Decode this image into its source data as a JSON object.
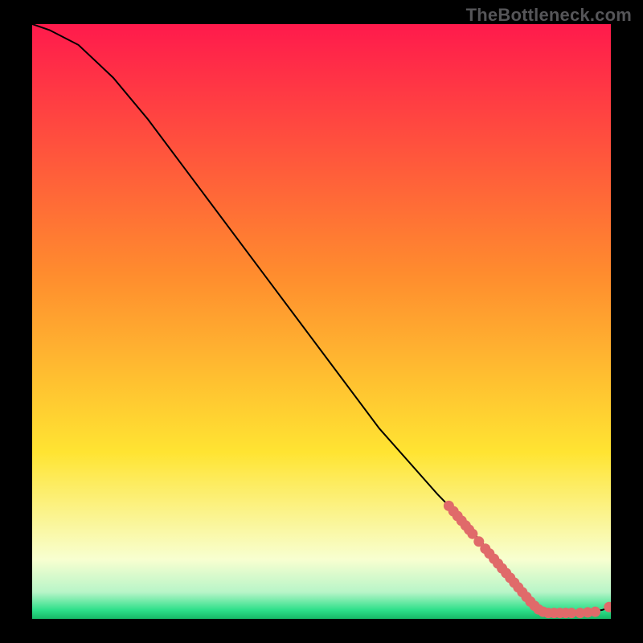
{
  "watermark": "TheBottleneck.com",
  "colors": {
    "page_bg": "#000000",
    "watermark": "#555558",
    "curve": "#000000",
    "marker_fill": "#e06a6a",
    "marker_stroke": "#c24f4f",
    "gradient_top": "#ff1a4c",
    "gradient_yellow": "#ffe432",
    "gradient_pale": "#f6ffe0",
    "gradient_green": "#2ee08a"
  },
  "chart_data": {
    "type": "line",
    "title": "",
    "xlabel": "",
    "ylabel": "",
    "xlim": [
      0,
      100
    ],
    "ylim": [
      0,
      100
    ],
    "curve": [
      {
        "x": 0,
        "y": 100
      },
      {
        "x": 3,
        "y": 99
      },
      {
        "x": 8,
        "y": 96.5
      },
      {
        "x": 14,
        "y": 91
      },
      {
        "x": 20,
        "y": 84
      },
      {
        "x": 30,
        "y": 71
      },
      {
        "x": 40,
        "y": 58
      },
      {
        "x": 50,
        "y": 45
      },
      {
        "x": 60,
        "y": 32
      },
      {
        "x": 70,
        "y": 21
      },
      {
        "x": 74,
        "y": 17
      },
      {
        "x": 78,
        "y": 12.5
      },
      {
        "x": 82,
        "y": 8
      },
      {
        "x": 85,
        "y": 4.5
      },
      {
        "x": 87,
        "y": 2.3
      },
      {
        "x": 88.5,
        "y": 1.2
      },
      {
        "x": 90,
        "y": 1.0
      },
      {
        "x": 93,
        "y": 1.0
      },
      {
        "x": 96,
        "y": 1.1
      },
      {
        "x": 98.5,
        "y": 1.5
      },
      {
        "x": 100,
        "y": 2.0
      }
    ],
    "markers": [
      {
        "x": 72.0,
        "y": 19.0
      },
      {
        "x": 72.8,
        "y": 18.1
      },
      {
        "x": 73.5,
        "y": 17.3
      },
      {
        "x": 74.2,
        "y": 16.5
      },
      {
        "x": 74.9,
        "y": 15.7
      },
      {
        "x": 75.5,
        "y": 15.0
      },
      {
        "x": 76.1,
        "y": 14.3
      },
      {
        "x": 77.2,
        "y": 13.0
      },
      {
        "x": 78.3,
        "y": 11.8
      },
      {
        "x": 79.0,
        "y": 11.0
      },
      {
        "x": 79.8,
        "y": 10.1
      },
      {
        "x": 80.5,
        "y": 9.3
      },
      {
        "x": 81.2,
        "y": 8.5
      },
      {
        "x": 81.9,
        "y": 7.7
      },
      {
        "x": 82.6,
        "y": 6.9
      },
      {
        "x": 83.3,
        "y": 6.1
      },
      {
        "x": 84.0,
        "y": 5.3
      },
      {
        "x": 84.7,
        "y": 4.5
      },
      {
        "x": 85.4,
        "y": 3.7
      },
      {
        "x": 86.1,
        "y": 2.9
      },
      {
        "x": 86.8,
        "y": 2.2
      },
      {
        "x": 87.5,
        "y": 1.6
      },
      {
        "x": 88.3,
        "y": 1.2
      },
      {
        "x": 89.2,
        "y": 1.0
      },
      {
        "x": 90.2,
        "y": 1.0
      },
      {
        "x": 91.2,
        "y": 1.0
      },
      {
        "x": 92.2,
        "y": 1.0
      },
      {
        "x": 93.2,
        "y": 1.0
      },
      {
        "x": 94.7,
        "y": 1.0
      },
      {
        "x": 96.0,
        "y": 1.1
      },
      {
        "x": 97.3,
        "y": 1.2
      },
      {
        "x": 99.7,
        "y": 2.0
      }
    ],
    "gradient_stops": [
      {
        "offset": 0.0,
        "color": "#ff1a4c"
      },
      {
        "offset": 0.42,
        "color": "#ff8c2e"
      },
      {
        "offset": 0.72,
        "color": "#ffe432"
      },
      {
        "offset": 0.9,
        "color": "#f8ffd0"
      },
      {
        "offset": 0.955,
        "color": "#b8f5c8"
      },
      {
        "offset": 0.985,
        "color": "#2ee08a"
      },
      {
        "offset": 1.0,
        "color": "#16b866"
      }
    ]
  }
}
